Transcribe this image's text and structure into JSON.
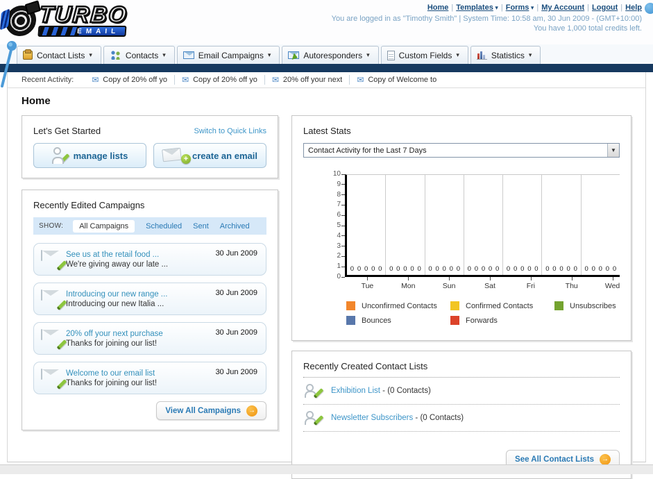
{
  "header": {
    "logo": {
      "title": "TURBO",
      "subtitle": "EMAIL"
    },
    "nav_links": [
      {
        "label": "Home",
        "dropdown": false
      },
      {
        "label": "Templates",
        "dropdown": true
      },
      {
        "label": "Forms",
        "dropdown": true
      },
      {
        "label": "My Account",
        "dropdown": false
      },
      {
        "label": "Logout",
        "dropdown": false
      },
      {
        "label": "Help",
        "dropdown": false
      }
    ],
    "login_info": "You are logged in as \"Timothy Smith\" | System Time: 10:58 am, 30 Jun 2009 - (GMT+10:00)",
    "credits_info": "You have 1,000 total credits left."
  },
  "nav_tabs": [
    {
      "label": "Contact Lists",
      "icon": "contact-book-icon",
      "icon_class": "ic-book"
    },
    {
      "label": "Contacts",
      "icon": "people-icon",
      "icon_class": "ic-people"
    },
    {
      "label": "Email Campaigns",
      "icon": "envelope-icon",
      "icon_class": "ic-env"
    },
    {
      "label": "Autoresponders",
      "icon": "envelope-arrow-icon",
      "icon_class": "ic-env-arrow"
    },
    {
      "label": "Custom Fields",
      "icon": "document-icon",
      "icon_class": "ic-doc"
    },
    {
      "label": "Statistics",
      "icon": "bar-chart-icon",
      "icon_class": "ic-bars"
    }
  ],
  "recent_activity": {
    "label": "Recent Activity:",
    "items": [
      "Copy of 20% off yo",
      "Copy of 20% off yo",
      "20% off your next",
      "Copy of Welcome to"
    ]
  },
  "page_title": "Home",
  "get_started": {
    "title": "Let's Get Started",
    "switch_link": "Switch to Quick Links",
    "buttons": [
      {
        "label": "manage lists",
        "icon": "person-pencil-icon"
      },
      {
        "label": "create an email",
        "icon": "envelope-plus-icon"
      }
    ]
  },
  "campaigns_panel": {
    "title": "Recently Edited Campaigns",
    "show_label": "SHOW:",
    "filters": [
      "All Campaigns",
      "Scheduled",
      "Sent",
      "Archived"
    ],
    "active_filter": "All Campaigns",
    "items": [
      {
        "title": "See us at the retail food ...",
        "subtitle": "We're giving away our late ...",
        "date": "30 Jun 2009"
      },
      {
        "title": "Introducing our new range ...",
        "subtitle": "Introducing our new Italia ...",
        "date": "30 Jun 2009"
      },
      {
        "title": "20% off your next purchase",
        "subtitle": "Thanks for joining our list!",
        "date": "30 Jun 2009"
      },
      {
        "title": "Welcome to our email list",
        "subtitle": "Thanks for joining our list!",
        "date": "30 Jun 2009"
      }
    ],
    "view_all_label": "View All Campaigns"
  },
  "stats_panel": {
    "title": "Latest Stats",
    "selected_option": "Contact Activity for the Last 7 Days"
  },
  "chart_data": {
    "type": "bar",
    "title": "Contact Activity for the Last 7 Days",
    "categories": [
      "Tue",
      "Mon",
      "Sun",
      "Sat",
      "Fri",
      "Thu",
      "Wed"
    ],
    "series": [
      {
        "name": "Unconfirmed Contacts",
        "color": "#f2862b",
        "values": [
          0,
          0,
          0,
          0,
          0,
          0,
          0
        ]
      },
      {
        "name": "Confirmed Contacts",
        "color": "#f2c522",
        "values": [
          0,
          0,
          0,
          0,
          0,
          0,
          0
        ]
      },
      {
        "name": "Unsubscribes",
        "color": "#74a32f",
        "values": [
          0,
          0,
          0,
          0,
          0,
          0,
          0
        ]
      },
      {
        "name": "Bounces",
        "color": "#5877ab",
        "values": [
          0,
          0,
          0,
          0,
          0,
          0,
          0
        ]
      },
      {
        "name": "Forwards",
        "color": "#dc432a",
        "values": [
          0,
          0,
          0,
          0,
          0,
          0,
          0
        ]
      }
    ],
    "ylim": [
      0,
      10
    ],
    "yticks": [
      0,
      1,
      2,
      3,
      4,
      5,
      6,
      7,
      8,
      9,
      10
    ],
    "grid": "vertical-only",
    "legend_position": "bottom",
    "data_labels": true
  },
  "contact_lists_panel": {
    "title": "Recently Created Contact Lists",
    "items": [
      {
        "name": "Exhibition List",
        "detail": " - (0 Contacts)"
      },
      {
        "name": "Newsletter Subscribers",
        "detail": " - (0 Contacts)"
      }
    ],
    "see_all_label": "See All Contact Lists"
  }
}
